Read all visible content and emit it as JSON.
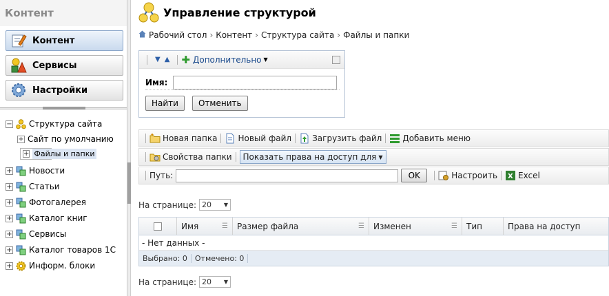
{
  "sidebar": {
    "title": "Контент",
    "buttons": [
      {
        "label": "Контент",
        "icon": "edit-note-icon"
      },
      {
        "label": "Сервисы",
        "icon": "shapes-icon"
      },
      {
        "label": "Настройки",
        "icon": "gear-icon"
      }
    ],
    "tree": [
      {
        "label": "Структура сайта",
        "expander": "−",
        "icon": "site-structure-icon"
      },
      {
        "label": "Сайт по умолчанию",
        "expander": "+",
        "icon": ""
      },
      {
        "label": "Файлы и папки",
        "expander": "+",
        "icon": ""
      },
      {
        "label": "Новости",
        "expander": "+",
        "icon": "module-icon"
      },
      {
        "label": "Статьи",
        "expander": "+",
        "icon": "module-icon"
      },
      {
        "label": "Фотогалерея",
        "expander": "+",
        "icon": "module-icon"
      },
      {
        "label": "Каталог книг",
        "expander": "+",
        "icon": "module-icon"
      },
      {
        "label": "Сервисы",
        "expander": "+",
        "icon": "module-icon"
      },
      {
        "label": "Каталог товаров 1С",
        "expander": "+",
        "icon": "module-icon"
      },
      {
        "label": "Информ. блоки",
        "expander": "+",
        "icon": "gear-group-icon"
      }
    ]
  },
  "page": {
    "title": "Управление структурой",
    "breadcrumbs": [
      "Рабочий стол",
      "Структура сайта",
      "Файлы и папки"
    ]
  },
  "filter": {
    "more_label": "Дополнительно",
    "name_label": "Имя:",
    "name_value": "",
    "find_label": "Найти",
    "cancel_label": "Отменить"
  },
  "toolbar1": {
    "new_folder": "Новая папка",
    "new_file": "Новый файл",
    "upload_file": "Загрузить файл",
    "add_menu": "Добавить меню"
  },
  "toolbar2": {
    "folder_props": "Свойства папки",
    "show_rights": "Показать права на доступ для"
  },
  "toolbar3": {
    "path_label": "Путь:",
    "path_value": "",
    "ok_label": "OK",
    "configure": "Настроить",
    "excel": "Excel"
  },
  "pager": {
    "label": "На странице:",
    "value": "20"
  },
  "grid": {
    "columns": [
      "Имя",
      "Размер файла",
      "Изменен",
      "Тип",
      "Права на доступ"
    ],
    "empty": "- Нет данных -",
    "footer": {
      "selected": "Выбрано: 0",
      "marked": "Отмечено: 0"
    }
  },
  "colors": {
    "accent": "#1a4a8c",
    "selection": "#dbe5f3"
  }
}
